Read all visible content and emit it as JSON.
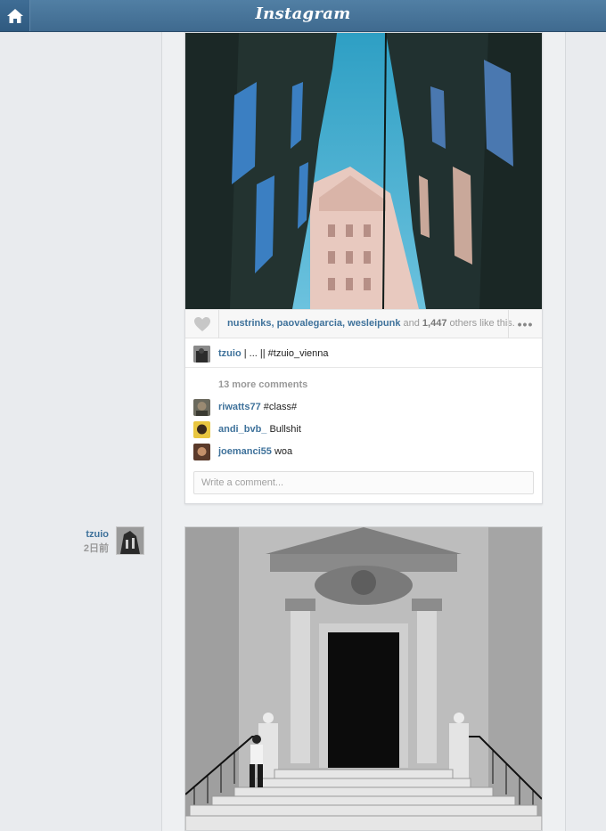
{
  "app": {
    "logo_text": "Instagram"
  },
  "header": {
    "home_icon": "home-icon"
  },
  "post1": {
    "likes": {
      "users": [
        "nustrinks",
        "paovalegarcia",
        "wesleipunk"
      ],
      "sep1": ", ",
      "sep2": ", ",
      "and_text": " and ",
      "count": "1,447",
      "suffix": " others like this."
    },
    "more_label": "•••",
    "caption": {
      "username": "tzuio",
      "text": "| ... || #tzuio_vienna"
    },
    "more_comments": "13 more comments",
    "comments": [
      {
        "username": "riwatts77",
        "text": "#class#"
      },
      {
        "username": "andi_bvb_",
        "text": "Bullshit"
      },
      {
        "username": "joemanci55",
        "text": "woa"
      }
    ],
    "comment_placeholder": "Write a comment..."
  },
  "post2": {
    "author": {
      "username": "tzuio",
      "time": "2日前"
    }
  }
}
